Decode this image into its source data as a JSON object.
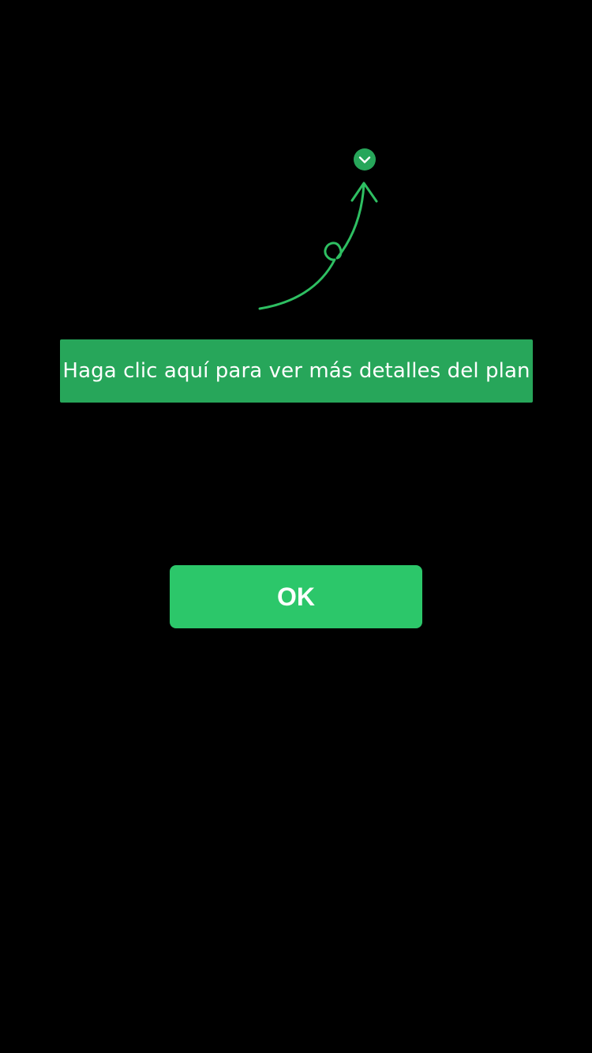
{
  "colors": {
    "background": "#000000",
    "accent": "#27a65a",
    "button": "#2cc76a",
    "arrow": "#2ebf62",
    "text": "#ffffff"
  },
  "icons": {
    "expand": "chevron-down-circle-icon",
    "pointer": "curved-arrow-icon"
  },
  "tooltip": {
    "text": "Haga clic aquí para ver más detalles del plan"
  },
  "ok_button": {
    "label": "OK"
  }
}
